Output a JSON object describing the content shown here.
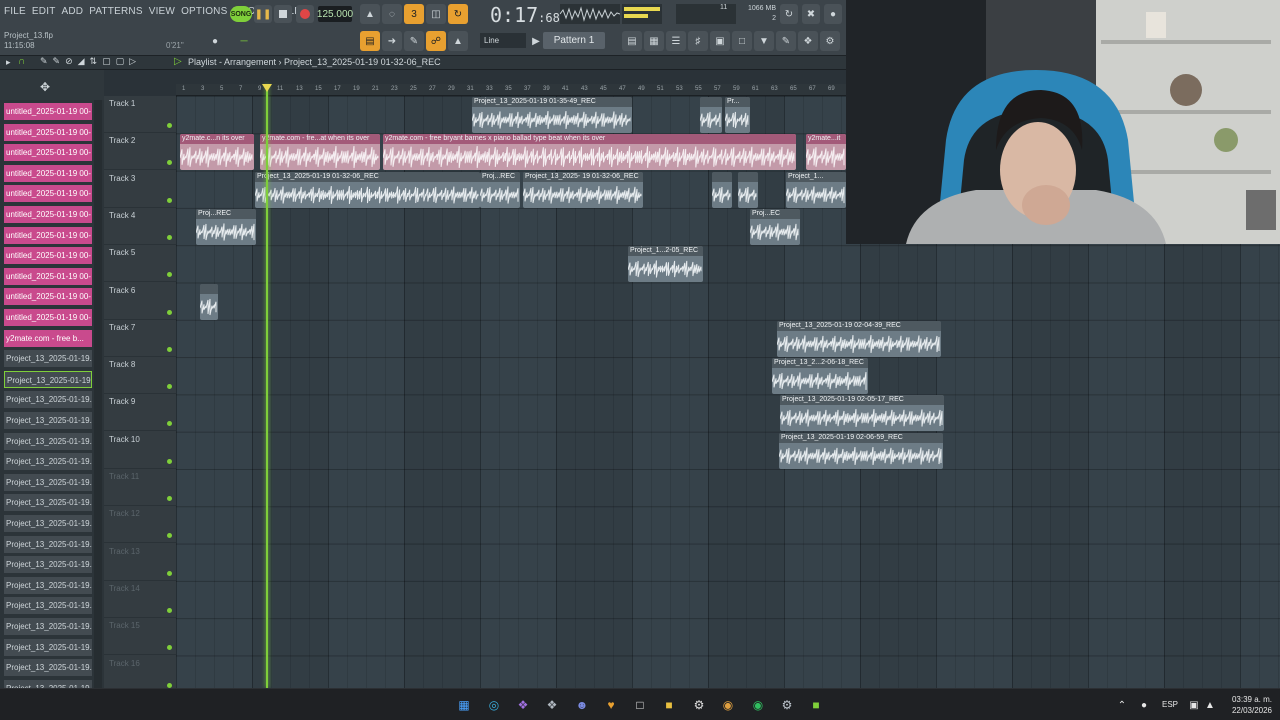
{
  "menu": [
    "FILE",
    "EDIT",
    "ADD",
    "PATTERNS",
    "VIEW",
    "OPTIONS",
    "TOOLS",
    "HELP"
  ],
  "project": {
    "file": "Project_13.flp",
    "time": "11:15:08",
    "small": "0'21\""
  },
  "transport": {
    "song": "SONG",
    "tempo": "125.000",
    "time": "0:17",
    "time_frac": ":68",
    "mcs": "M:S:CS",
    "cpu": "11",
    "mem": "1066 MB",
    "mem2": "2"
  },
  "toolbar2": {
    "snap": "Line",
    "pattern": "Pattern 1"
  },
  "playlist": {
    "title": "Playlist - Arrangement",
    "path": "Project_13_2025-01-19 01-32-06_REC"
  },
  "sidebar_items": [
    {
      "label": "untitled_2025-01-19 00-",
      "style": "pink"
    },
    {
      "label": "untitled_2025-01-19 00-",
      "style": "pink"
    },
    {
      "label": "untitled_2025-01-19 00-",
      "style": "pink"
    },
    {
      "label": "untitled_2025-01-19 00-",
      "style": "pink"
    },
    {
      "label": "untitled_2025-01-19 00-",
      "style": "pink"
    },
    {
      "label": "untitled_2025-01-19 00-",
      "style": "pink"
    },
    {
      "label": "untitled_2025-01-19 00-",
      "style": "pink"
    },
    {
      "label": "untitled_2025-01-19 00-",
      "style": "pink"
    },
    {
      "label": "untitled_2025-01-19 00-",
      "style": "pink"
    },
    {
      "label": "untitled_2025-01-19 00-",
      "style": "pink"
    },
    {
      "label": "untitled_2025-01-19 00-",
      "style": "pink"
    },
    {
      "label": "y2mate.com - free b...",
      "style": "pink"
    },
    {
      "label": "Project_13_2025-01-19..",
      "style": "gray"
    },
    {
      "label": "Project_13_2025-01-19..",
      "style": "gray sel"
    },
    {
      "label": "Project_13_2025-01-19..",
      "style": "gray"
    },
    {
      "label": "Project_13_2025-01-19..",
      "style": "gray"
    },
    {
      "label": "Project_13_2025-01-19..",
      "style": "gray"
    },
    {
      "label": "Project_13_2025-01-19..",
      "style": "gray"
    },
    {
      "label": "Project_13_2025-01-19..",
      "style": "gray"
    },
    {
      "label": "Project_13_2025-01-19..",
      "style": "gray"
    },
    {
      "label": "Project_13_2025-01-19..",
      "style": "gray"
    },
    {
      "label": "Project_13_2025-01-19..",
      "style": "gray"
    },
    {
      "label": "Project_13_2025-01-19..",
      "style": "gray"
    },
    {
      "label": "Project_13_2025-01-19..",
      "style": "gray"
    },
    {
      "label": "Project_13_2025-01-19..",
      "style": "gray"
    },
    {
      "label": "Project_13_2025-01-19..",
      "style": "gray"
    },
    {
      "label": "Project_13_2025-01-19..",
      "style": "gray"
    },
    {
      "label": "Project_13_2025-01-19..",
      "style": "gray"
    },
    {
      "label": "Project_13_2025-01-19..",
      "style": "gray"
    }
  ],
  "tracks": [
    "Track 1",
    "Track 2",
    "Track 3",
    "Track 4",
    "Track 5",
    "Track 6",
    "Track 7",
    "Track 8",
    "Track 9",
    "Track 10",
    "Track 11",
    "Track 12",
    "Track 13",
    "Track 14",
    "Track 15",
    "Track 16"
  ],
  "ruler": [
    "1",
    "3",
    "5",
    "7",
    "9",
    "11",
    "13",
    "15",
    "17",
    "19",
    "21",
    "23",
    "25",
    "27",
    "29",
    "31",
    "33",
    "35",
    "37",
    "39",
    "41",
    "43",
    "45",
    "47",
    "49",
    "51",
    "53",
    "55",
    "57",
    "59",
    "61",
    "63",
    "65",
    "67",
    "69"
  ],
  "clips": [
    {
      "track": 0,
      "label": "Project_13_2025-01-19 01-35-49_REC",
      "style": "gray"
    },
    {
      "track": 0,
      "label": "",
      "style": "gray"
    },
    {
      "track": 0,
      "label": "Pr...",
      "style": "gray"
    },
    {
      "track": 1,
      "label": "y2mate.c...n its over",
      "style": "pink"
    },
    {
      "track": 1,
      "label": "y2mate.com - fre...at when its over",
      "style": "pink"
    },
    {
      "track": 1,
      "label": "y2mate.com - free bryant barnes x piano ballad type beat when its over",
      "style": "pink"
    },
    {
      "track": 1,
      "label": "y2mate...it",
      "style": "pink"
    },
    {
      "track": 2,
      "label": "Project_13_2025-01-19 01-32-06_REC",
      "style": "gray"
    },
    {
      "track": 2,
      "label": "Proj...REC",
      "style": "gray"
    },
    {
      "track": 2,
      "label": "Project_13_2025- 19 01-32-06_REC",
      "style": "gray"
    },
    {
      "track": 2,
      "label": "",
      "style": "gray"
    },
    {
      "track": 2,
      "label": "",
      "style": "gray"
    },
    {
      "track": 2,
      "label": "Project_1...",
      "style": "gray"
    },
    {
      "track": 3,
      "label": "Proj...REC",
      "style": "gray"
    },
    {
      "track": 3,
      "label": "Proj...EC",
      "style": "gray"
    },
    {
      "track": 4,
      "label": "Project_1...2-05_REC",
      "style": "gray"
    },
    {
      "track": 5,
      "label": "",
      "style": "gray"
    },
    {
      "track": 6,
      "label": "Project_13_2025-01-19 02-04-39_REC",
      "style": "gray"
    },
    {
      "track": 7,
      "label": "Project_13_2...2-06-18_REC",
      "style": "gray"
    },
    {
      "track": 8,
      "label": "Project_13_2025-01-19 02-05-17_REC",
      "style": "gray"
    },
    {
      "track": 9,
      "label": "Project_13_2025-01-19 02-06-59_REC",
      "style": "gray"
    }
  ],
  "taskbar": {
    "lang": "ESP",
    "time": "03:39 a. m.",
    "date": "22/03/2026"
  }
}
